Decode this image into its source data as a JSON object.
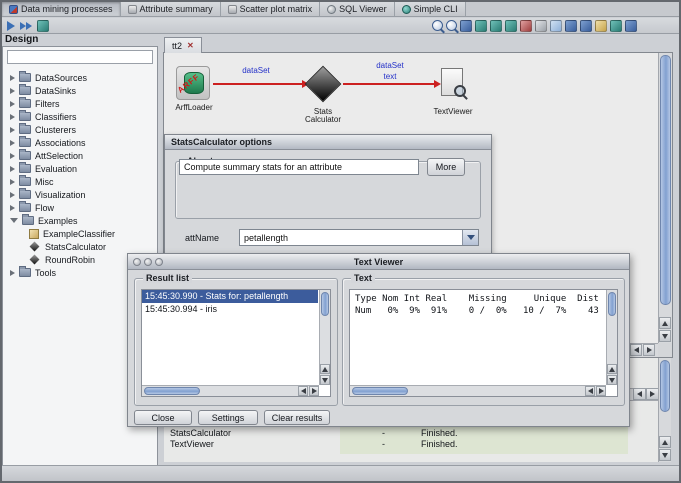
{
  "top_tabs": {
    "items": [
      {
        "label": "Data mining processes"
      },
      {
        "label": "Attribute summary"
      },
      {
        "label": "Scatter plot matrix"
      },
      {
        "label": "SQL Viewer"
      },
      {
        "label": "Simple CLI"
      }
    ]
  },
  "design": {
    "title": "Design",
    "filter_value": "",
    "tree": [
      {
        "label": "DataSources"
      },
      {
        "label": "DataSinks"
      },
      {
        "label": "Filters"
      },
      {
        "label": "Classifiers"
      },
      {
        "label": "Clusterers"
      },
      {
        "label": "Associations"
      },
      {
        "label": "AttSelection"
      },
      {
        "label": "Evaluation"
      },
      {
        "label": "Misc"
      },
      {
        "label": "Visualization"
      },
      {
        "label": "Flow"
      },
      {
        "label": "Examples"
      },
      {
        "label": "ExampleClassifier"
      },
      {
        "label": "StatsCalculator"
      },
      {
        "label": "RoundRobin"
      },
      {
        "label": "Tools"
      }
    ]
  },
  "flow": {
    "tab_label": "tt2",
    "nodes": [
      {
        "label": "ArffLoader",
        "icon_text": "ARFF"
      },
      {
        "label_line1": "Stats",
        "label_line2": "Calculator"
      },
      {
        "label": "TextViewer"
      }
    ],
    "connection_labels": [
      "dataSet",
      "dataSet",
      "text"
    ]
  },
  "stats_dialog": {
    "title": "StatsCalculator options",
    "about_label": "About",
    "about_text": "Compute summary stats for an attribute",
    "more_button": "More",
    "attname_label": "attName",
    "attname_value": "petallength"
  },
  "text_viewer": {
    "title": "Text Viewer",
    "result_list_label": "Result list",
    "results": [
      {
        "label": "15:45:30.990 - Stats for: petallength"
      },
      {
        "label": "15:45:30.994 - iris"
      }
    ],
    "text_label": "Text",
    "text_line1": "Type Nom Int Real    Missing     Unique  Dist",
    "text_line2": "Num   0%  9%  91%    0 /  0%   10 /  7%    43",
    "buttons": {
      "close": "Close",
      "settings": "Settings",
      "clear": "Clear results"
    }
  },
  "log": {
    "rows": [
      {
        "name": "StatsCalculator",
        "col2": "-",
        "status": "Finished."
      },
      {
        "name": "TextViewer",
        "col2": "-",
        "status": "Finished."
      }
    ]
  },
  "icons": {
    "close_tab": "✕"
  }
}
